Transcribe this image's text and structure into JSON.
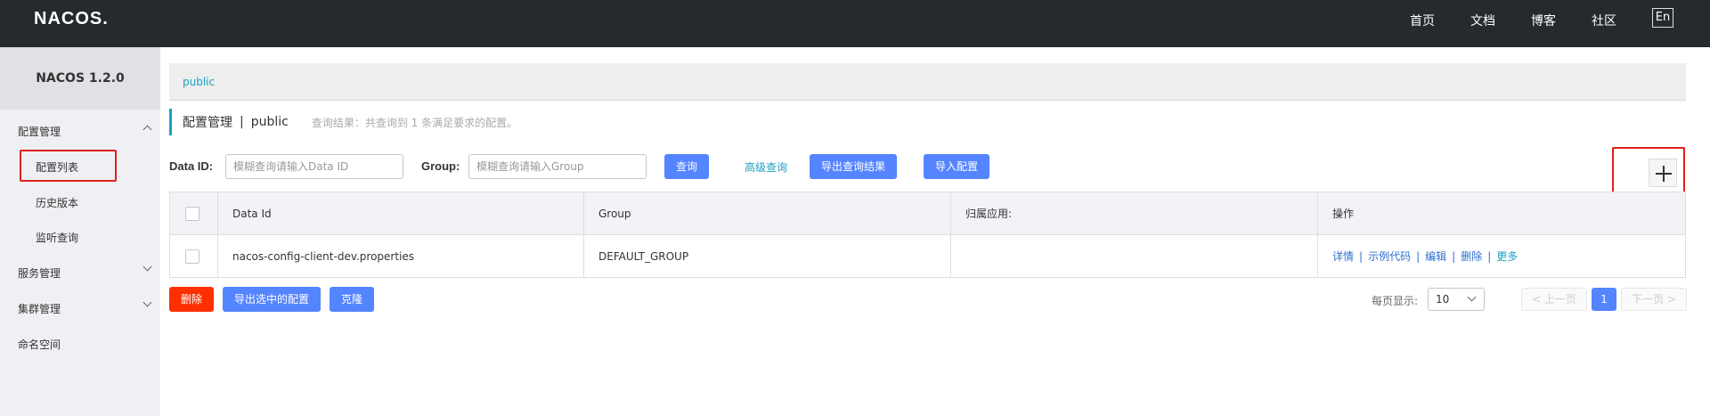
{
  "header": {
    "logo": "NACOS.",
    "nav": [
      "首页",
      "文档",
      "博客",
      "社区"
    ],
    "lang": "En"
  },
  "sidebar": {
    "title": "NACOS 1.2.0",
    "items": [
      {
        "label": "配置管理",
        "chevron": "up"
      },
      {
        "label": "配置列表",
        "selected": true
      },
      {
        "label": "历史版本"
      },
      {
        "label": "监听查询"
      },
      {
        "label": "服务管理",
        "chevron": "down"
      },
      {
        "label": "集群管理",
        "chevron": "down"
      },
      {
        "label": "命名空间"
      }
    ]
  },
  "breadcrumb": "public",
  "page": {
    "title": "配置管理",
    "separator": "|",
    "namespace": "public",
    "result_text": "查询结果：共查询到 1 条满足要求的配置。"
  },
  "filters": {
    "data_id_label": "Data ID:",
    "data_id_placeholder": "模糊查询请输入Data ID",
    "group_label": "Group:",
    "group_placeholder": "模糊查询请输入Group",
    "search_button": "查询",
    "advanced_search": "高级查询",
    "export_results_button": "导出查询结果",
    "import_button": "导入配置"
  },
  "table": {
    "headers": [
      "Data Id",
      "Group",
      "归属应用:",
      "操作"
    ],
    "rows": [
      {
        "data_id": "nacos-config-client-dev.properties",
        "group": "DEFAULT_GROUP",
        "app": "",
        "ops": [
          "详情",
          "示例代码",
          "编辑",
          "删除",
          "更多"
        ]
      }
    ],
    "op_separator": "|"
  },
  "bulk_actions": {
    "delete": "删除",
    "export_selected": "导出选中的配置",
    "clone": "克隆"
  },
  "pagination": {
    "per_page_label": "每页显示:",
    "per_page_value": "10",
    "prev": "< 上一页",
    "current": "1",
    "next": "下一页 >"
  },
  "colors": {
    "header_bg": "#252a2f",
    "primary": "#5584ff",
    "danger": "#ff3000",
    "link": "#1aa1c0",
    "highlight_red": "#e0201a"
  }
}
